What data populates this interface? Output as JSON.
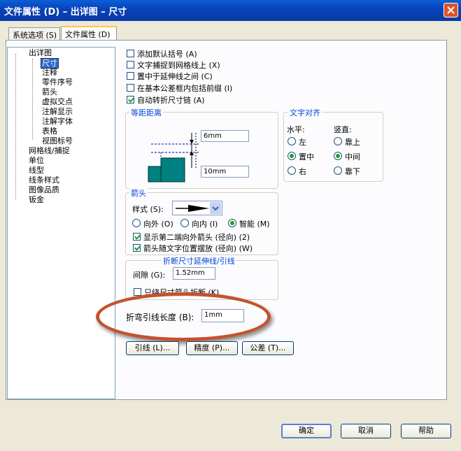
{
  "window": {
    "title": "文件属性 (D) – 出详图 – 尺寸"
  },
  "tabs": [
    {
      "label": "系统选项 (S)",
      "active": false
    },
    {
      "label": "文件属性 (D)",
      "active": true
    }
  ],
  "tree": {
    "root": "出详图",
    "children": [
      "尺寸",
      "注释",
      "零件序号",
      "箭头",
      "虚拟交点",
      "注解显示",
      "注解字体",
      "表格",
      "视图标号"
    ],
    "selected": "尺寸",
    "top_items": [
      "网格线/捕捉",
      "单位",
      "线型",
      "线条样式",
      "图像品质",
      "钣金"
    ]
  },
  "options": [
    {
      "label": "添加默认括号 (A)",
      "checked": false
    },
    {
      "label": "文字捕捉到网格线上 (X)",
      "checked": false
    },
    {
      "label": "置中于延伸线之间 (C)",
      "checked": false
    },
    {
      "label": "在基本公差框内包括前缀 (I)",
      "checked": false
    },
    {
      "label": "自动转折尺寸链 (A)",
      "checked": true
    }
  ],
  "offset_group": {
    "title": "等距距离",
    "top_value": "6mm",
    "bottom_value": "10mm"
  },
  "text_align_group": {
    "title": "文字对齐",
    "horizontal_label": "水平:",
    "vertical_label": "竖直:",
    "horizontal": [
      {
        "label": "左",
        "checked": false
      },
      {
        "label": "置中",
        "checked": true
      },
      {
        "label": "右",
        "checked": false
      }
    ],
    "vertical": [
      {
        "label": "靠上",
        "checked": false
      },
      {
        "label": "中间",
        "checked": true
      },
      {
        "label": "靠下",
        "checked": false
      }
    ]
  },
  "arrow_group": {
    "title": "箭头",
    "style_label": "样式 (S):",
    "radios": [
      {
        "label": "向外 (O)",
        "checked": false
      },
      {
        "label": "向内 (I)",
        "checked": false
      },
      {
        "label": "智能 (M)",
        "checked": true
      }
    ],
    "checks": [
      {
        "label": "显示第二端向外箭头 (径向) (2)",
        "checked": true
      },
      {
        "label": "箭头随文字位置摆放 (径向) (W)",
        "checked": true
      }
    ]
  },
  "break_group": {
    "title": "折断尺寸延伸线/引线",
    "gap_label": "间隙 (G):",
    "gap_value": "1.52mm",
    "only_label": "只绕尺寸箭头折断 (K)",
    "only_checked": false
  },
  "bend": {
    "label": "折弯引线长度 (B):",
    "value": "1mm"
  },
  "bottom_buttons": [
    "引线 (L)...",
    "精度 (P)...",
    "公差 (T)..."
  ],
  "dialog_buttons": [
    "确定",
    "取消",
    "帮助"
  ],
  "colors": {
    "titlebar": "#0a5fd8",
    "highlight_ellipse": "#c4522c",
    "group_title": "#0046d5"
  }
}
